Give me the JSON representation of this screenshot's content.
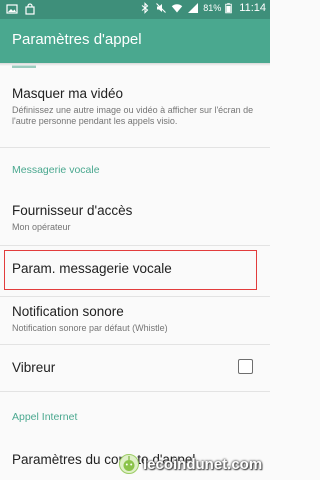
{
  "status_bar": {
    "time": "11:14",
    "battery": "81%",
    "icons": [
      "gallery-icon",
      "shopping-bag-icon",
      "bluetooth-icon",
      "mute-icon",
      "wifi-icon",
      "signal-icon",
      "battery-icon"
    ],
    "color": "#3e8f7a"
  },
  "app_bar": {
    "title": "Paramètres d'appel",
    "color": "#4aa88f"
  },
  "items": {
    "masquer_video": {
      "title": "Masquer ma vidéo",
      "subtitle": "Définissez une autre image ou vidéo à afficher sur l'écran de l'autre personne pendant les appels visio."
    },
    "section_messagerie": "Messagerie vocale",
    "fournisseur": {
      "title": "Fournisseur d'accès",
      "subtitle": "Mon opérateur"
    },
    "param_messagerie": {
      "title": "Param. messagerie vocale"
    },
    "notification_sonore": {
      "title": "Notification sonore",
      "subtitle": "Notification sonore par défaut (Whistle)"
    },
    "vibreur": {
      "title": "Vibreur",
      "checked": false
    },
    "section_internet": "Appel Internet",
    "parametres_compte": {
      "title": "Paramètres du compte d'appel"
    }
  },
  "highlight_color": "#e23c3c",
  "watermark": {
    "text": "lecoindunet.com"
  }
}
